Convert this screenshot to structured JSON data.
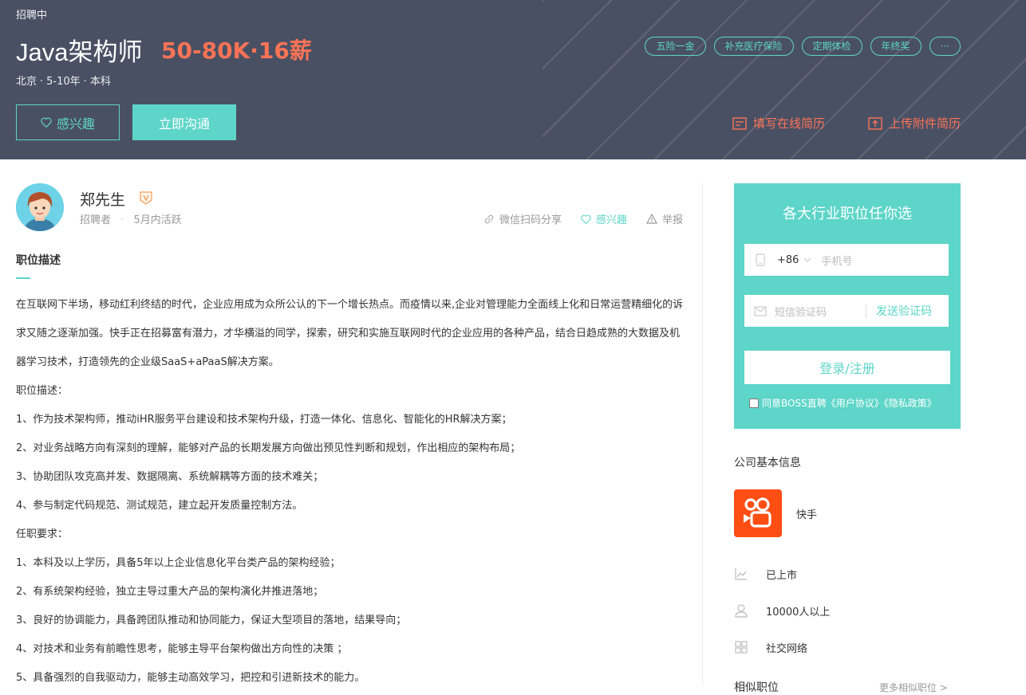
{
  "header": {
    "status": "招聘中",
    "job_title": "Java架构师",
    "salary": "50-80K·16薪",
    "city": "北京",
    "experience": "5-10年",
    "education": "本科",
    "tags": [
      "五险一金",
      "补充医疗保险",
      "定期体检",
      "年终奖",
      "···"
    ],
    "interest_label": "感兴趣",
    "chat_label": "立即沟通",
    "online_resume_label": "填写在线简历",
    "upload_resume_label": "上传附件简历"
  },
  "recruiter": {
    "name": "郑先生",
    "role": "招聘者",
    "active": "5月内活跃",
    "share_label": "微信扫码分享",
    "interest_label": "感兴趣",
    "report_label": "举报"
  },
  "description": {
    "title": "职位描述",
    "paragraphs": [
      "在互联网下半场，移动红利终结的时代，企业应用成为众所公认的下一个增长热点。而疫情以来,企业对管理能力全面线上化和日常运营精细化的诉求又随之逐渐加强。快手正在招募富有潜力，才华横溢的同学，探索，研究和实施互联网时代的企业应用的各种产品，结合日趋成熟的大数据及机器学习技术，打造领先的企业级SaaS+aPaaS解决方案。",
      "职位描述：",
      "1、作为技术架构师，推动iHR服务平台建设和技术架构升级，打造一体化、信息化、智能化的HR解决方案；",
      "2、对业务战略方向有深刻的理解，能够对产品的长期发展方向做出预见性判断和规划，作出相应的架构布局；",
      "3、协助团队攻克高并发、数据隔离、系统解耦等方面的技术难关；",
      "4、参与制定代码规范、测试规范，建立起开发质量控制方法。",
      "任职要求：",
      "1、本科及以上学历，具备5年以上企业信息化平台类产品的架构经验；",
      "2、有系统架构经验，独立主导过重大产品的架构演化并推进落地；",
      "3、良好的协调能力，具备跨团队推动和协同能力，保证大型项目的落地，结果导向；",
      "4、对技术和业务有前瞻性思考，能够主导平台架构做出方向性的决策 ；",
      "5、具备强烈的自我驱动力，能够主动高效学习，把控和引进新技术的能力。"
    ]
  },
  "login": {
    "title": "各大行业职位任你选",
    "country_code": "+86",
    "phone_placeholder": "手机号",
    "code_placeholder": "短信验证码",
    "send_code_label": "发送验证码",
    "login_label": "登录/注册",
    "agree_text": "同意BOSS直聘《用户协议》《隐私政策》"
  },
  "company": {
    "heading": "公司基本信息",
    "name": "快手",
    "stage": "已上市",
    "size": "10000人以上",
    "industry": "社交网络"
  },
  "related": {
    "heading": "相似职位",
    "more_label": "更多相似职位 >"
  },
  "colors": {
    "banner": "#4a5064",
    "accent": "#5dd5c8",
    "salary": "#fd7356",
    "logo": "#fe4e14"
  }
}
